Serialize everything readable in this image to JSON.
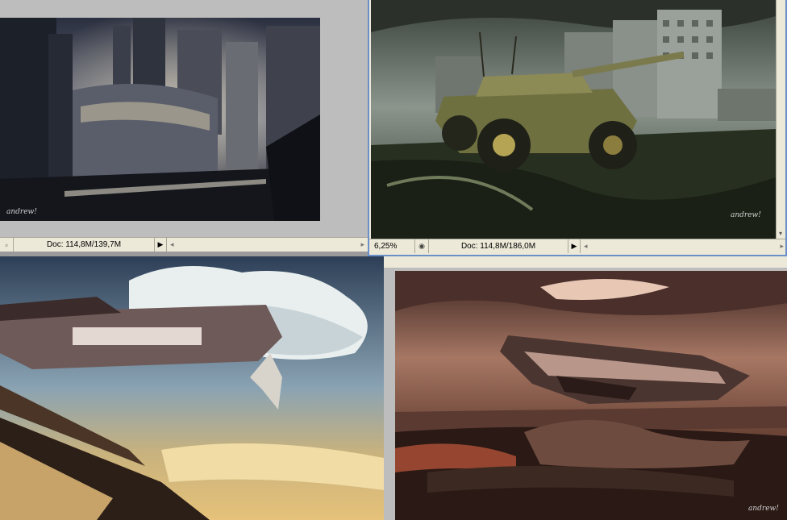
{
  "windows": [
    {
      "id": "city",
      "status": {
        "zoom": "",
        "doc": "Doc: 114,8M/139,7M"
      },
      "signature": "andrew!"
    },
    {
      "id": "tank",
      "status": {
        "zoom": "6,25%",
        "doc": "Doc: 114,8M/186,0M"
      },
      "signature": "andrew!"
    },
    {
      "id": "airship",
      "signature": ""
    },
    {
      "id": "red-ship",
      "signature": "andrew!"
    }
  ],
  "icons": {
    "nav": "navigator-icon",
    "menu_arrow": "play-arrow-icon",
    "scroll_left": "scroll-left-arrow-icon",
    "scroll_right": "scroll-right-arrow-icon"
  },
  "colors": {
    "workspace": "#9a9a9a",
    "statusbar": "#ece9d8",
    "active_border": "#6b8fc8"
  }
}
